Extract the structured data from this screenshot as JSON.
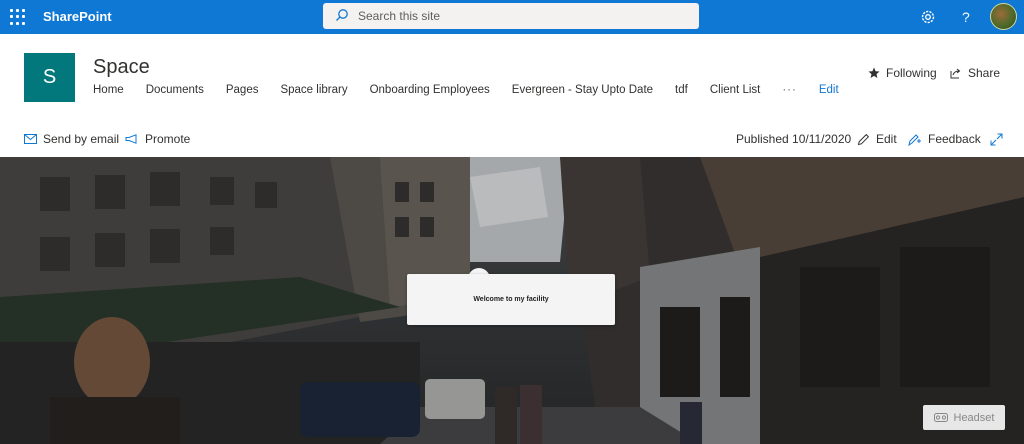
{
  "suite_bar": {
    "brand": "SharePoint",
    "search_placeholder": "Search this site",
    "accent": "#0f78d4"
  },
  "site": {
    "logo_letter": "S",
    "logo_color": "#03787c",
    "title": "Space",
    "nav": [
      "Home",
      "Documents",
      "Pages",
      "Space library",
      "Onboarding Employees",
      "Evergreen - Stay Upto Date",
      "tdf",
      "Client List"
    ],
    "nav_more": "···",
    "nav_edit": "Edit",
    "following": "Following",
    "share": "Share"
  },
  "command_bar": {
    "send_email": "Send by email",
    "promote": "Promote",
    "published": "Published 10/11/2020",
    "edit": "Edit",
    "feedback": "Feedback"
  },
  "hero": {
    "welcome_text": "Welcome to my facility",
    "headset_label": "Headset"
  },
  "icons": [
    "waffle-icon",
    "search-icon",
    "settings-icon",
    "help-icon",
    "star-icon",
    "share-icon",
    "email-icon",
    "promote-icon",
    "edit-icon",
    "feedback-icon",
    "expand-icon",
    "headset-icon"
  ]
}
